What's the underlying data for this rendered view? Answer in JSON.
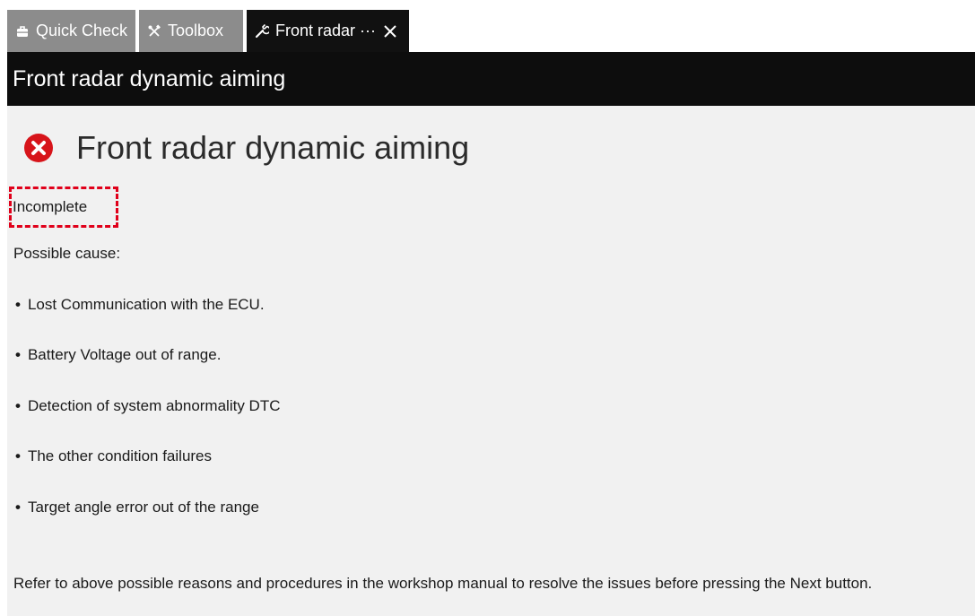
{
  "tabs": [
    {
      "label": "Quick Check",
      "icon": "toolbox-bag-icon"
    },
    {
      "label": "Toolbox",
      "icon": "crossed-tools-icon"
    },
    {
      "label": "Front radar ···",
      "icon": "wrench-icon",
      "active": true
    }
  ],
  "title_bar": {
    "title": "Front radar dynamic aiming"
  },
  "result": {
    "heading": "Front radar dynamic aiming",
    "status": "Incomplete",
    "status_icon": "error-icon",
    "status_color": "#e0001a",
    "cause_label": "Possible cause:",
    "causes": [
      "Lost Communication with the ECU.",
      "Battery Voltage out of range.",
      "Detection of system abnormality DTC",
      "The other condition failures",
      "Target angle error out of the range"
    ],
    "bullet": "•",
    "note": "Refer to above possible reasons and procedures in the workshop manual to resolve the issues before pressing the Next button."
  }
}
